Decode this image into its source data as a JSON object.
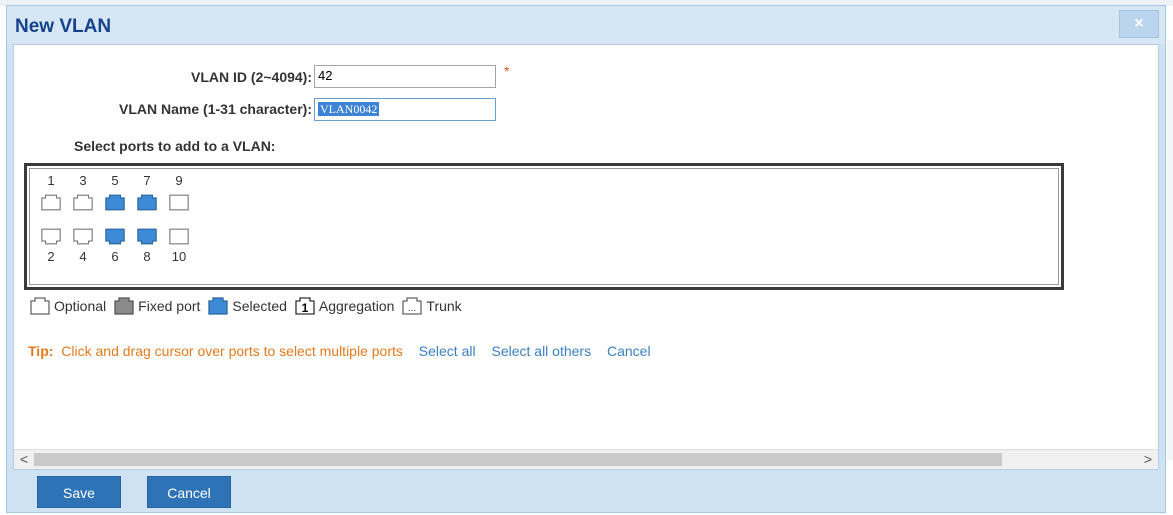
{
  "dialog": {
    "title": "New VLAN",
    "close_label": "×"
  },
  "form": {
    "vlan_id_label": "VLAN ID (2~4094):",
    "vlan_id_value": "42",
    "required_mark": "*",
    "vlan_name_label": "VLAN Name (1-31 character):",
    "vlan_name_value": "VLAN0042",
    "select_ports_label": "Select ports to add to a VLAN:"
  },
  "ports": [
    {
      "number": "1",
      "state": "optional"
    },
    {
      "number": "2",
      "state": "optional"
    },
    {
      "number": "3",
      "state": "optional"
    },
    {
      "number": "4",
      "state": "optional"
    },
    {
      "number": "5",
      "state": "selected"
    },
    {
      "number": "6",
      "state": "selected"
    },
    {
      "number": "7",
      "state": "selected"
    },
    {
      "number": "8",
      "state": "selected"
    },
    {
      "number": "9",
      "state": "sfp"
    },
    {
      "number": "10",
      "state": "sfp"
    }
  ],
  "legend": {
    "optional": "Optional",
    "fixed": "Fixed port",
    "selected": "Selected",
    "aggregation": "Aggregation",
    "aggregation_icon_text": "1",
    "trunk": "Trunk",
    "trunk_icon_text": "..."
  },
  "tip": {
    "label": "Tip:",
    "text": "Click and drag cursor over ports to select multiple ports",
    "select_all": "Select all",
    "select_all_others": "Select all others",
    "cancel": "Cancel"
  },
  "scrollbar": {
    "left_arrow": "<",
    "right_arrow": ">"
  },
  "buttons": {
    "save": "Save",
    "cancel": "Cancel"
  },
  "colors": {
    "selected_port": "#3d8bd6",
    "optional_port": "#ffffff",
    "fixed_port": "#8a8a8a",
    "tip": "#e37a1e",
    "link": "#3b80c4",
    "button": "#2f73b7"
  }
}
